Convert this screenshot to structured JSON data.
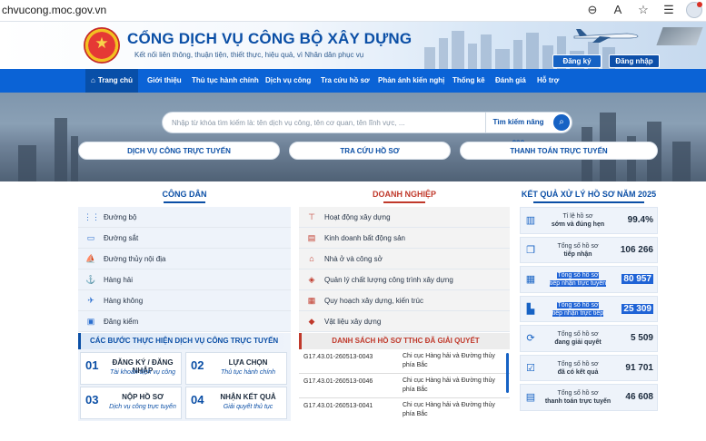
{
  "browser": {
    "url": "chvucong.moc.gov.vn"
  },
  "header": {
    "title": "CỔNG DỊCH VỤ CÔNG BỘ XÂY DỰNG",
    "subtitle": "Kết nối liên thông, thuận tiện, thiết thực, hiệu quả, vì Nhân dân phục vụ",
    "register_label": "Đăng ký",
    "login_label": "Đăng nhập"
  },
  "nav": {
    "items": [
      "Trang chủ",
      "Giới thiệu",
      "Thủ tục hành chính",
      "Dịch vụ công",
      "Tra cứu hồ sơ",
      "Phản ánh kiến nghị",
      "Thống kê",
      "Đánh giá",
      "Hỗ trợ"
    ]
  },
  "search": {
    "placeholder": "Nhập từ khóa tìm kiếm là: tên dịch vụ công, tên cơ quan, tên lĩnh vực, ...",
    "advanced_label": "Tìm kiếm nâng cao"
  },
  "quick_links": [
    "DỊCH VỤ CÔNG TRỰC TUYẾN",
    "TRA CỨU HỒ SƠ",
    "THANH TOÁN TRỰC TUYẾN"
  ],
  "citizen": {
    "heading": "CÔNG DÂN",
    "items": [
      {
        "label": "Đường bộ",
        "icon": "road-icon"
      },
      {
        "label": "Đường sắt",
        "icon": "train-icon"
      },
      {
        "label": "Đường thủy nội địa",
        "icon": "boat-icon"
      },
      {
        "label": "Hàng hải",
        "icon": "anchor-icon"
      },
      {
        "label": "Hàng không",
        "icon": "plane-icon"
      },
      {
        "label": "Đăng kiểm",
        "icon": "inspection-icon"
      }
    ]
  },
  "business": {
    "heading": "DOANH NGHIỆP",
    "items": [
      {
        "label": "Hoạt động xây dựng",
        "icon": "crane-icon"
      },
      {
        "label": "Kinh doanh bất động sản",
        "icon": "building-icon"
      },
      {
        "label": "Nhà ở và công sở",
        "icon": "house-icon"
      },
      {
        "label": "Quản lý chất lượng công trình xây dựng",
        "icon": "quality-icon"
      },
      {
        "label": "Quy hoạch xây dựng, kiến trúc",
        "icon": "planning-icon"
      },
      {
        "label": "Vật liệu xây dựng",
        "icon": "materials-icon"
      }
    ]
  },
  "steps": {
    "title": "CÁC BƯỚC THỰC HIỆN DỊCH VỤ CÔNG TRỰC TUYẾN",
    "items": [
      {
        "num": "01",
        "title": "ĐĂNG KÝ / ĐĂNG NHẬP",
        "sub": "Tài khoản dịch vụ công"
      },
      {
        "num": "02",
        "title": "LỰA CHỌN",
        "sub": "Thủ tục hành chính"
      },
      {
        "num": "03",
        "title": "NỘP HỒ SƠ",
        "sub": "Dịch vụ công trực tuyến"
      },
      {
        "num": "04",
        "title": "NHẬN KẾT QUẢ",
        "sub": "Giải quyết thủ tục"
      }
    ]
  },
  "dossiers": {
    "title": "DANH SÁCH HỒ SƠ TTHC ĐÃ GIẢI QUYẾT",
    "rows": [
      {
        "code": "G17.43.01-260513-0043",
        "org": "Chi cục Hàng hải và Đường thủy phía Bắc"
      },
      {
        "code": "G17.43.01-260513-0046",
        "org": "Chi cục Hàng hải và Đường thủy phía Bắc"
      },
      {
        "code": "G17.43.01-260513-0041",
        "org": "Chi cục Hàng hải và Đường thủy phía Bắc"
      }
    ]
  },
  "results": {
    "heading": "KẾT QUẢ XỬ LÝ HỒ SƠ NĂM 2025",
    "stats": [
      {
        "label1": "Tỉ lệ hồ sơ",
        "label2": "sớm và đúng hẹn",
        "value": "99.4%",
        "icon": "chart-icon",
        "highlight": false
      },
      {
        "label1": "Tổng số hồ sơ",
        "label2": "tiếp nhận",
        "value": "106 266",
        "icon": "document-icon",
        "highlight": false
      },
      {
        "label1": "Tổng số hồ sơ",
        "label2": "tiếp nhận trực tuyến",
        "value": "80 957",
        "icon": "grid-icon",
        "highlight": true
      },
      {
        "label1": "Tổng số hồ sơ",
        "label2": "tiếp nhận trực tiếp",
        "value": "25 309",
        "icon": "folder-icon",
        "highlight": true
      },
      {
        "label1": "Tổng số hồ sơ",
        "label2": "đang giải quyết",
        "value": "5 509",
        "icon": "processing-icon",
        "highlight": false
      },
      {
        "label1": "Tổng số hồ sơ",
        "label2": "đã có kết quả",
        "value": "91 701",
        "icon": "result-icon",
        "highlight": false
      },
      {
        "label1": "Tổng số hồ sơ",
        "label2": "thanh toán trực tuyến",
        "value": "46 608",
        "icon": "payment-icon",
        "highlight": false
      }
    ]
  },
  "colors": {
    "primary": "#0b63d6",
    "accent_red": "#c0392b",
    "highlight": "#1f63d6"
  }
}
